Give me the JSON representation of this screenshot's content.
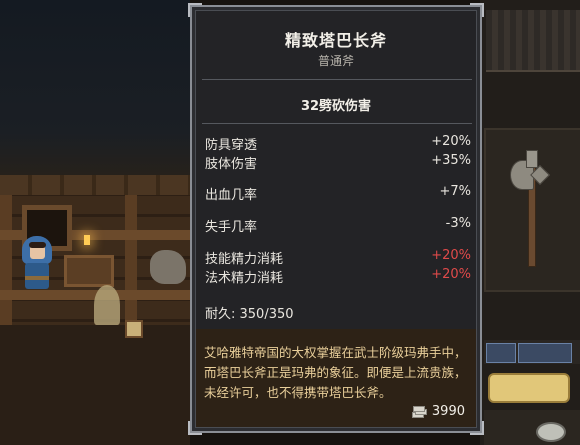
{
  "tooltip": {
    "title": "精致塔巴长斧",
    "subtitle": "普通斧",
    "damage": "32劈砍伤害",
    "stats": [
      {
        "label": "防具穿透",
        "value": "+20%",
        "negative": false
      },
      {
        "label": "肢体伤害",
        "value": "+35%",
        "negative": false
      },
      {
        "label": "出血几率",
        "value": "+7%",
        "negative": false
      },
      {
        "label": "失手几率",
        "value": "-3%",
        "negative": false
      },
      {
        "label": "技能精力消耗",
        "value": "+20%",
        "negative": true
      },
      {
        "label": "法术精力消耗",
        "value": "+20%",
        "negative": true
      }
    ],
    "durability": "耐久: 350/350",
    "description": "艾哈雅特帝国的大权掌握在武士阶级玛弗手中，而塔巴长斧正是玛弗的象征。即便是上流贵族，未经许可，也不得携带塔巴长斧。",
    "price": "3990",
    "price_icon": "coins-icon"
  },
  "colors": {
    "negative": "#e04a4a",
    "description": "#e9cf9a",
    "panel_bg": "#232326",
    "panel_border": "#8a8e95"
  }
}
